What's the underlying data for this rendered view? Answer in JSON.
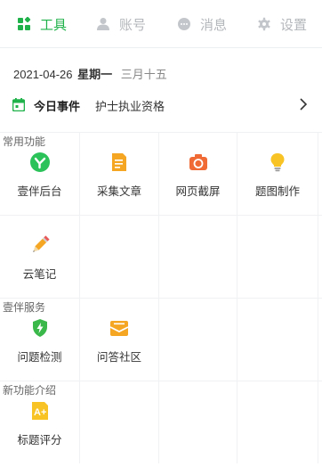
{
  "tabs": [
    {
      "label": "工具",
      "icon": "grid-icon",
      "active": true
    },
    {
      "label": "账号",
      "icon": "user-icon",
      "active": false
    },
    {
      "label": "消息",
      "icon": "chat-icon",
      "active": false
    },
    {
      "label": "设置",
      "icon": "gear-icon",
      "active": false
    }
  ],
  "date": {
    "date": "2021-04-26",
    "weekday": "星期一",
    "lunar": "三月十五"
  },
  "event": {
    "label": "今日事件",
    "text": "护士执业资格",
    "icon": "calendar-icon"
  },
  "sections": [
    {
      "title": "常用功能",
      "items": [
        {
          "label": "壹伴后台",
          "icon": "checkmark-logo-icon"
        },
        {
          "label": "采集文章",
          "icon": "document-icon"
        },
        {
          "label": "网页截屏",
          "icon": "camera-icon"
        },
        {
          "label": "题图制作",
          "icon": "lightbulb-icon"
        },
        {
          "label": "云笔记",
          "icon": "pencil-icon"
        }
      ]
    },
    {
      "title": "壹伴服务",
      "items": [
        {
          "label": "问题检测",
          "icon": "shield-bolt-icon"
        },
        {
          "label": "问答社区",
          "icon": "envelope-icon"
        }
      ]
    },
    {
      "title": "新功能介绍",
      "items": [
        {
          "label": "标题评分",
          "icon": "a-plus-icon"
        }
      ]
    }
  ],
  "colors": {
    "accent": "#20b24a",
    "muted": "#b4b7bb"
  }
}
